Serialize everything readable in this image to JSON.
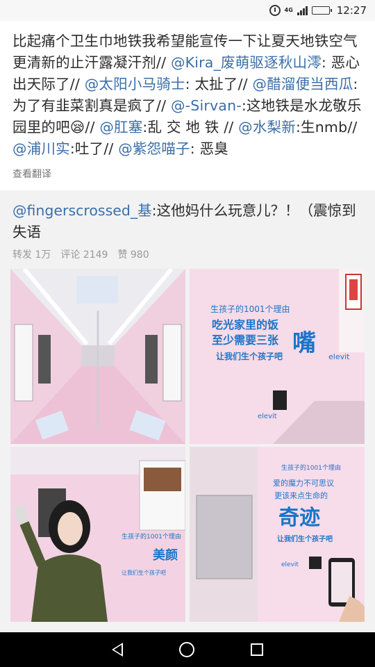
{
  "status_bar": {
    "network": "4G",
    "time": "12:27"
  },
  "post": {
    "segments": [
      {
        "text": "比起痛个卫生巾地铁我希望能宣传一下让夏天地铁空气更清新的止汗露凝汗剂// ",
        "type": "text"
      },
      {
        "text": "@Kira_废萌驱逐秋山澪",
        "type": "mention"
      },
      {
        "text": ": 恶心出天际了// ",
        "type": "text"
      },
      {
        "text": "@太阳小马骑士",
        "type": "mention"
      },
      {
        "text": ": 太扯了// ",
        "type": "text"
      },
      {
        "text": "@醋溜便当西瓜",
        "type": "mention"
      },
      {
        "text": ":为了有韭菜割真是疯了// ",
        "type": "text"
      },
      {
        "text": "@-Sirvan-",
        "type": "mention"
      },
      {
        "text": ":这地铁是水龙敬乐园里的吧😪// ",
        "type": "text"
      },
      {
        "text": "@肛塞",
        "type": "mention"
      },
      {
        "text": ":乱 交 地 铁 // ",
        "type": "text"
      },
      {
        "text": "@水梨新",
        "type": "mention"
      },
      {
        "text": ":生nmb// ",
        "type": "text"
      },
      {
        "text": "@浦川实",
        "type": "mention"
      },
      {
        "text": ":吐了// ",
        "type": "text"
      },
      {
        "text": "@紫怨喵子",
        "type": "mention"
      },
      {
        "text": ": 恶臭",
        "type": "text"
      }
    ],
    "translate_label": "查看翻译"
  },
  "repost": {
    "author": "@fingerscrossed_基",
    "text": ":这他妈什么玩意儿？！（震惊到失语",
    "stats": {
      "forward": "转发 1万",
      "comment": "评论 2149",
      "like": "赞 980"
    }
  },
  "images": {
    "ad2": {
      "header": "生孩子的1001个理由",
      "line1": "吃光家里的饭",
      "line2": "至少需要三张",
      "line3": "嘴",
      "line4": "让我们生个孩子吧",
      "brand": "elevit"
    },
    "ad3": {
      "header": "生孩子的1001个理由",
      "big": "美颜",
      "line": "让我们生个孩子吧"
    },
    "ad4": {
      "header": "生孩子的1001个理由",
      "line1": "爱的魔力不可思议",
      "line2": "更该来点生命的",
      "big": "奇迹",
      "line3": "让我们生个孩子吧",
      "brand": "elevit"
    }
  },
  "colors": {
    "mention": "#3b6ea8",
    "pink": "#f2c9dd",
    "ad_blue": "#1b75c9"
  }
}
